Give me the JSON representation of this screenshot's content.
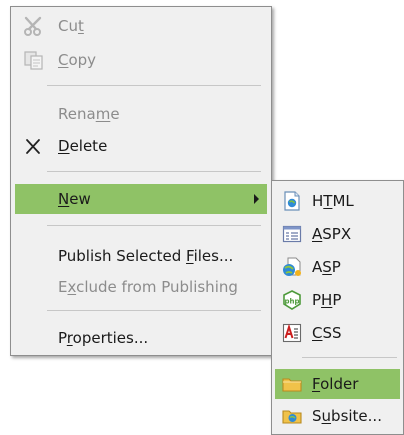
{
  "main_menu": {
    "cut": {
      "pre": "Cu",
      "accel": "t",
      "post": ""
    },
    "copy": {
      "pre": "",
      "accel": "C",
      "post": "opy"
    },
    "rename": {
      "pre": "Rena",
      "accel": "m",
      "post": "e"
    },
    "delete": {
      "pre": "",
      "accel": "D",
      "post": "elete"
    },
    "new": {
      "pre": "",
      "accel": "N",
      "post": "ew"
    },
    "publish": {
      "pre": "Publish Selected ",
      "accel": "F",
      "post": "iles..."
    },
    "exclude": {
      "pre": "E",
      "accel": "x",
      "post": "clude from Publishing"
    },
    "properties": {
      "pre": "P",
      "accel": "r",
      "post": "operties..."
    }
  },
  "sub_menu": {
    "html": {
      "pre": "H",
      "accel": "T",
      "post": "ML"
    },
    "aspx": {
      "pre": "",
      "accel": "A",
      "post": "SPX"
    },
    "asp": {
      "pre": "A",
      "accel": "S",
      "post": "P"
    },
    "php": {
      "pre": "P",
      "accel": "H",
      "post": "P"
    },
    "css": {
      "pre": "",
      "accel": "C",
      "post": "SS"
    },
    "folder": {
      "pre": "",
      "accel": "F",
      "post": "older"
    },
    "subsite": {
      "pre": "S",
      "accel": "u",
      "post": "bsite..."
    }
  },
  "icons": {
    "cut": "scissors-icon",
    "copy": "copy-icon",
    "delete": "delete-x-icon",
    "html": "html-file-icon",
    "aspx": "aspx-file-icon",
    "asp": "asp-file-icon",
    "php": "php-file-icon",
    "css": "css-file-icon",
    "folder": "folder-icon",
    "subsite": "subsite-folder-icon"
  },
  "colors": {
    "highlight": "#8fc266",
    "menu_background": "#f0f0f0",
    "disabled_text": "#8c8c8c"
  }
}
